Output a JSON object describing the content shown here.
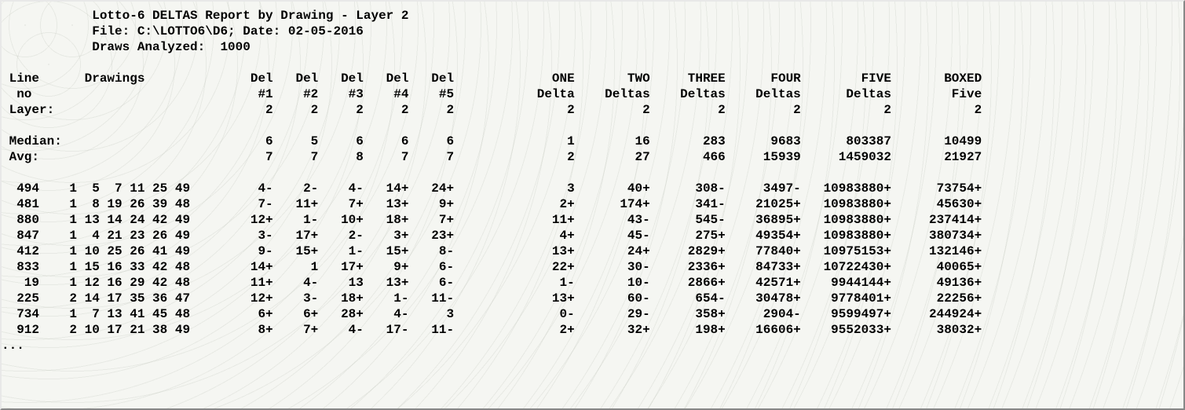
{
  "header": {
    "title": "Lotto-6 DELTAS Report by Drawing - Layer 2",
    "file_label": "File:",
    "file_path": "C:\\LOTTO6\\D6;",
    "date_label": "Date:",
    "date_value": "02-05-2016",
    "draws_label": "Draws Analyzed:",
    "draws_value": "1000"
  },
  "columns": {
    "line_no": "Line\n no",
    "drawings": "Drawings",
    "dels": [
      "Del\n#1",
      "Del\n#2",
      "Del\n#3",
      "Del\n#4",
      "Del\n#5"
    ],
    "groups": [
      "ONE\nDelta",
      "TWO\nDeltas",
      "THREE\nDeltas",
      "FOUR\nDeltas",
      "FIVE\nDeltas",
      "BOXED\nFive"
    ]
  },
  "layer_label": "Layer:",
  "layer_values": {
    "dels": [
      "2",
      "2",
      "2",
      "2",
      "2"
    ],
    "groups": [
      "2",
      "2",
      "2",
      "2",
      "2",
      "2"
    ]
  },
  "median_label": "Median:",
  "median": {
    "dels": [
      "6",
      "5",
      "6",
      "6",
      "6"
    ],
    "groups": [
      "1",
      "16",
      "283",
      "9683",
      "803387",
      "10499"
    ]
  },
  "avg_label": "Avg:",
  "avg": {
    "dels": [
      "7",
      "7",
      "8",
      "7",
      "7"
    ],
    "groups": [
      "2",
      "27",
      "466",
      "15939",
      "1459032",
      "21927"
    ]
  },
  "rows": [
    {
      "line": "494",
      "d": [
        "1",
        "5",
        "7",
        "11",
        "25",
        "49"
      ],
      "del": [
        "4-",
        "2-",
        "4-",
        "14+",
        "24+"
      ],
      "g": [
        "3",
        "40+",
        "308-",
        "3497-",
        "10983880+",
        "73754+"
      ]
    },
    {
      "line": "481",
      "d": [
        "1",
        "8",
        "19",
        "26",
        "39",
        "48"
      ],
      "del": [
        "7-",
        "11+",
        "7+",
        "13+",
        "9+"
      ],
      "g": [
        "2+",
        "174+",
        "341-",
        "21025+",
        "10983880+",
        "45630+"
      ]
    },
    {
      "line": "880",
      "d": [
        "1",
        "13",
        "14",
        "24",
        "42",
        "49"
      ],
      "del": [
        "12+",
        "1-",
        "10+",
        "18+",
        "7+"
      ],
      "g": [
        "11+",
        "43-",
        "545-",
        "36895+",
        "10983880+",
        "237414+"
      ]
    },
    {
      "line": "847",
      "d": [
        "1",
        "4",
        "21",
        "23",
        "26",
        "49"
      ],
      "del": [
        "3-",
        "17+",
        "2-",
        "3+",
        "23+"
      ],
      "g": [
        "4+",
        "45-",
        "275+",
        "49354+",
        "10983880+",
        "380734+"
      ]
    },
    {
      "line": "412",
      "d": [
        "1",
        "10",
        "25",
        "26",
        "41",
        "49"
      ],
      "del": [
        "9-",
        "15+",
        "1-",
        "15+",
        "8-"
      ],
      "g": [
        "13+",
        "24+",
        "2829+",
        "77840+",
        "10975153+",
        "132146+"
      ]
    },
    {
      "line": "833",
      "d": [
        "1",
        "15",
        "16",
        "33",
        "42",
        "48"
      ],
      "del": [
        "14+",
        "1",
        "17+",
        "9+",
        "6-"
      ],
      "g": [
        "22+",
        "30-",
        "2336+",
        "84733+",
        "10722430+",
        "40065+"
      ]
    },
    {
      "line": "19",
      "d": [
        "1",
        "12",
        "16",
        "29",
        "42",
        "48"
      ],
      "del": [
        "11+",
        "4-",
        "13",
        "13+",
        "6-"
      ],
      "g": [
        "1-",
        "10-",
        "2866+",
        "42571+",
        "9944144+",
        "49136+"
      ]
    },
    {
      "line": "225",
      "d": [
        "2",
        "14",
        "17",
        "35",
        "36",
        "47"
      ],
      "del": [
        "12+",
        "3-",
        "18+",
        "1-",
        "11-"
      ],
      "g": [
        "13+",
        "60-",
        "654-",
        "30478+",
        "9778401+",
        "22256+"
      ]
    },
    {
      "line": "734",
      "d": [
        "1",
        "7",
        "13",
        "41",
        "45",
        "48"
      ],
      "del": [
        "6+",
        "6+",
        "28+",
        "4-",
        "3"
      ],
      "g": [
        "0-",
        "29-",
        "358+",
        "2904-",
        "9599497+",
        "244924+"
      ]
    },
    {
      "line": "912",
      "d": [
        "2",
        "10",
        "17",
        "21",
        "38",
        "49"
      ],
      "del": [
        "8+",
        "7+",
        "4-",
        "17-",
        "11-"
      ],
      "g": [
        "2+",
        "32+",
        "198+",
        "16606+",
        "9552033+",
        "38032+"
      ]
    }
  ],
  "ellipsis": "..."
}
